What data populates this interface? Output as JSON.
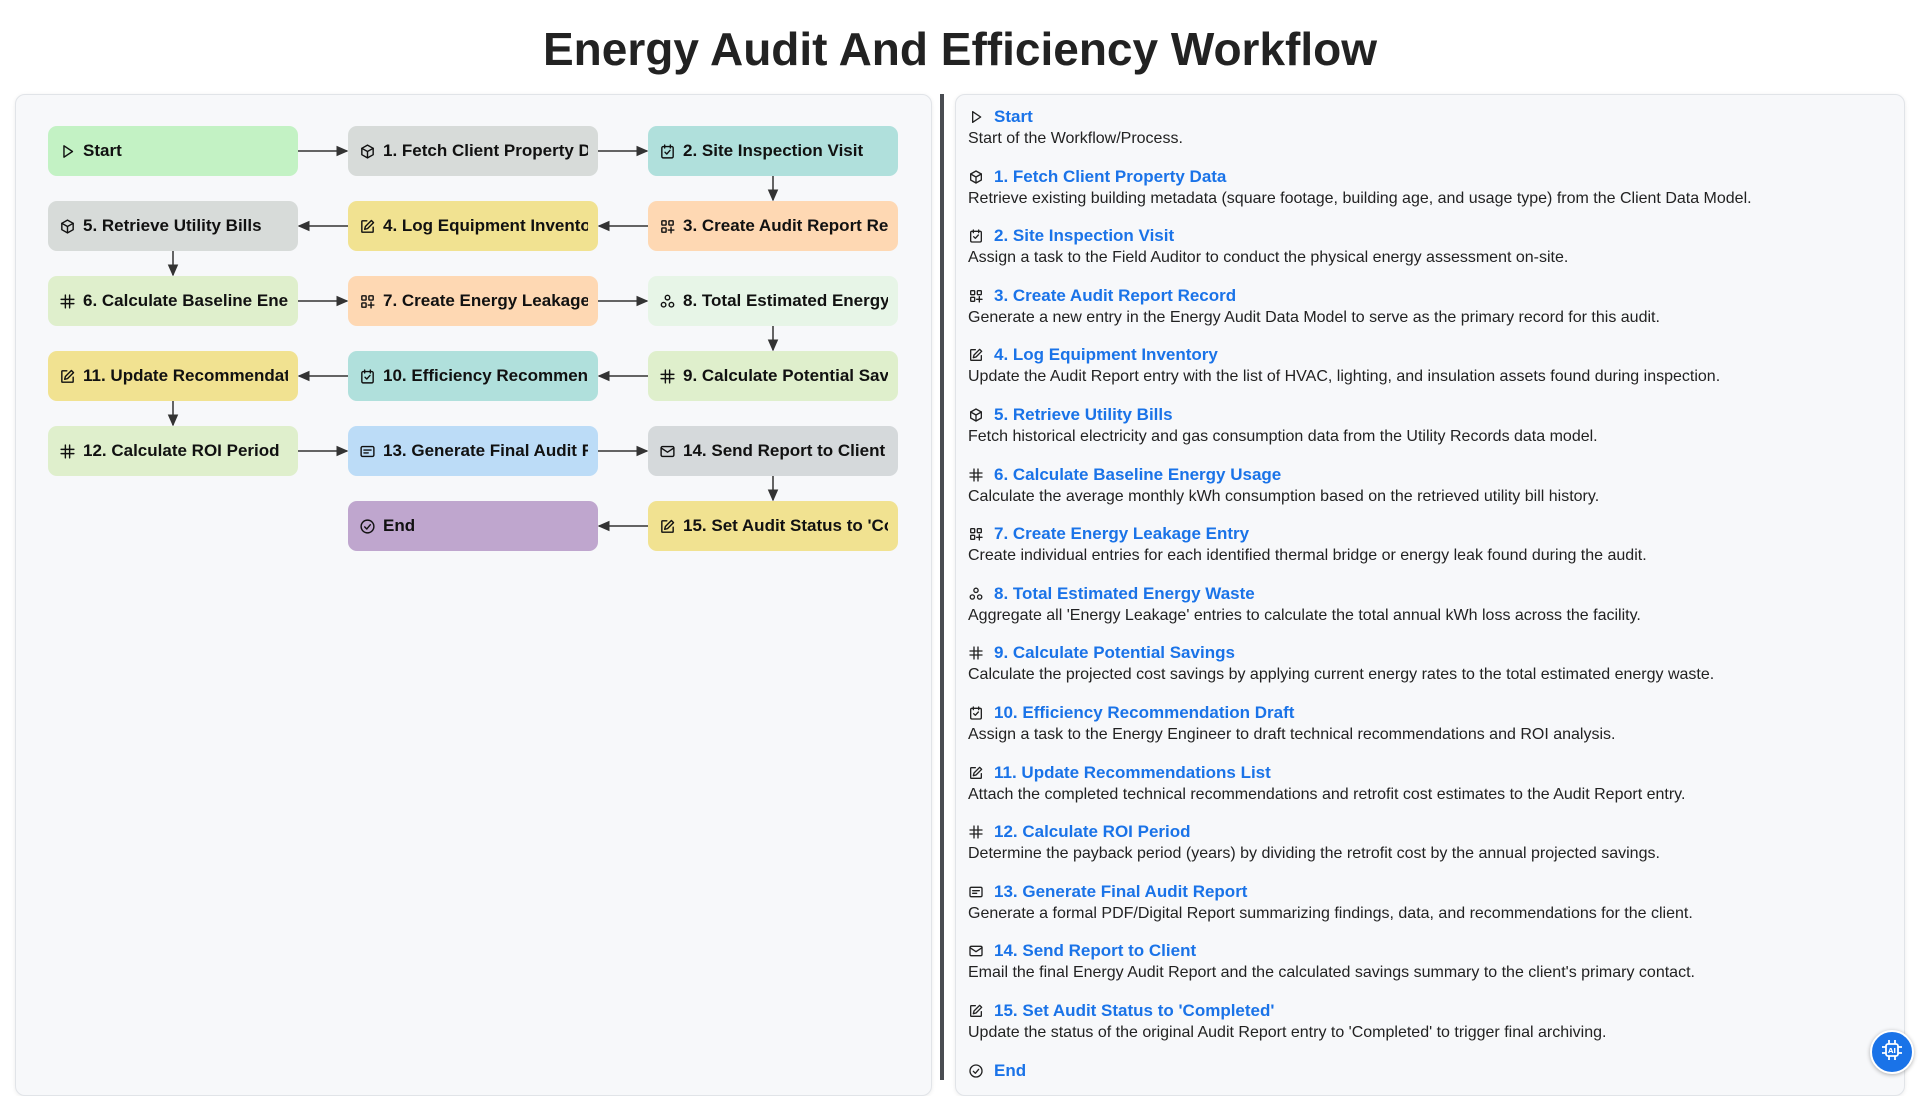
{
  "title": "Energy Audit And Efficiency Workflow",
  "colors": {
    "start": "#c3f2c4",
    "end": "#bfa6ce",
    "fetch": "#d7dbd9",
    "task": "#b0e0dc",
    "create": "#fed8b3",
    "update": "#f1e291",
    "calc": "#dfefcc",
    "aggregate": "#e7f5e7",
    "report": "#bcdcf7",
    "email": "#d5d9db",
    "link": "#1a73e8"
  },
  "nodes": [
    {
      "label": "Start",
      "icon": "play-icon",
      "color": "start"
    },
    {
      "label": "1. Fetch Client Property Data",
      "icon": "cube-icon",
      "color": "fetch"
    },
    {
      "label": "2. Site Inspection Visit",
      "icon": "task-check-icon",
      "color": "task"
    },
    {
      "label": "3. Create Audit Report Record",
      "icon": "grid-plus-icon",
      "color": "create"
    },
    {
      "label": "4. Log Equipment Inventory",
      "icon": "edit-icon",
      "color": "update"
    },
    {
      "label": "5. Retrieve Utility Bills",
      "icon": "cube-icon",
      "color": "fetch"
    },
    {
      "label": "6. Calculate Baseline Energy Usage",
      "icon": "calc-icon",
      "color": "calc"
    },
    {
      "label": "7. Create Energy Leakage Entry",
      "icon": "grid-plus-icon",
      "color": "create"
    },
    {
      "label": "8. Total Estimated Energy Waste",
      "icon": "aggregate-icon",
      "color": "aggregate"
    },
    {
      "label": "9. Calculate Potential Savings",
      "icon": "calc-icon",
      "color": "calc"
    },
    {
      "label": "10. Efficiency Recommendation Draft",
      "icon": "task-check-icon",
      "color": "task"
    },
    {
      "label": "11. Update Recommendations List",
      "icon": "edit-icon",
      "color": "update"
    },
    {
      "label": "12. Calculate ROI Period",
      "icon": "calc-icon",
      "color": "calc"
    },
    {
      "label": "13. Generate Final Audit Report",
      "icon": "report-icon",
      "color": "report"
    },
    {
      "label": "14. Send Report to Client",
      "icon": "mail-icon",
      "color": "email"
    },
    {
      "label": "15. Set Audit Status to 'Completed'",
      "icon": "edit-icon",
      "color": "update"
    },
    {
      "label": "End",
      "icon": "circle-check-icon",
      "color": "end"
    }
  ],
  "steps": [
    {
      "title": "Start",
      "icon": "play-icon",
      "desc": "Start of the Workflow/Process."
    },
    {
      "title": "1. Fetch Client Property Data",
      "icon": "cube-icon",
      "desc": "Retrieve existing building metadata (square footage, building age, and usage type) from the Client Data Model."
    },
    {
      "title": "2. Site Inspection Visit",
      "icon": "task-check-icon",
      "desc": "Assign a task to the Field Auditor to conduct the physical energy assessment on-site."
    },
    {
      "title": "3. Create Audit Report Record",
      "icon": "grid-plus-icon",
      "desc": "Generate a new entry in the Energy Audit Data Model to serve as the primary record for this audit."
    },
    {
      "title": "4. Log Equipment Inventory",
      "icon": "edit-icon",
      "desc": "Update the Audit Report entry with the list of HVAC, lighting, and insulation assets found during inspection."
    },
    {
      "title": "5. Retrieve Utility Bills",
      "icon": "cube-icon",
      "desc": "Fetch historical electricity and gas consumption data from the Utility Records data model."
    },
    {
      "title": "6. Calculate Baseline Energy Usage",
      "icon": "calc-icon",
      "desc": "Calculate the average monthly kWh consumption based on the retrieved utility bill history."
    },
    {
      "title": "7. Create Energy Leakage Entry",
      "icon": "grid-plus-icon",
      "desc": "Create individual entries for each identified thermal bridge or energy leak found during the audit."
    },
    {
      "title": "8. Total Estimated Energy Waste",
      "icon": "aggregate-icon",
      "desc": "Aggregate all 'Energy Leakage' entries to calculate the total annual kWh loss across the facility."
    },
    {
      "title": "9. Calculate Potential Savings",
      "icon": "calc-icon",
      "desc": "Calculate the projected cost savings by applying current energy rates to the total estimated energy waste."
    },
    {
      "title": "10. Efficiency Recommendation Draft",
      "icon": "task-check-icon",
      "desc": "Assign a task to the Energy Engineer to draft technical recommendations and ROI analysis."
    },
    {
      "title": "11. Update Recommendations List",
      "icon": "edit-icon",
      "desc": "Attach the completed technical recommendations and retrofit cost estimates to the Audit Report entry."
    },
    {
      "title": "12. Calculate ROI Period",
      "icon": "calc-icon",
      "desc": "Determine the payback period (years) by dividing the retrofit cost by the annual projected savings."
    },
    {
      "title": "13. Generate Final Audit Report",
      "icon": "report-icon",
      "desc": "Generate a formal PDF/Digital Report summarizing findings, data, and recommendations for the client."
    },
    {
      "title": "14. Send Report to Client",
      "icon": "mail-icon",
      "desc": "Email the final Energy Audit Report and the calculated savings summary to the client's primary contact."
    },
    {
      "title": "15. Set Audit Status to 'Completed'",
      "icon": "edit-icon",
      "desc": "Update the status of the original Audit Report entry to 'Completed' to trigger final archiving."
    },
    {
      "title": "End",
      "icon": "circle-check-icon",
      "desc": ""
    }
  ],
  "fab_icon": "ai-chip-icon"
}
